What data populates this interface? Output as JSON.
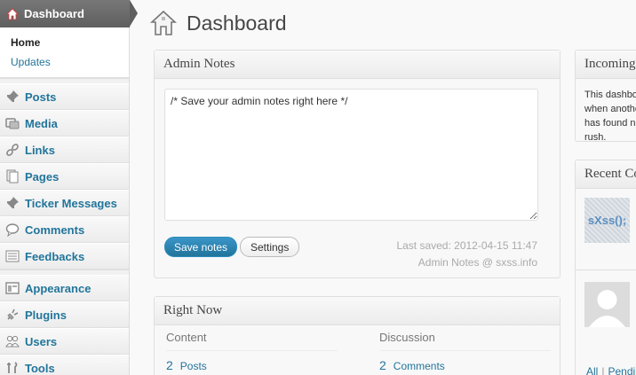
{
  "sidebar": {
    "dashboard_label": "Dashboard",
    "submenu": {
      "home": "Home",
      "updates": "Updates"
    },
    "items": [
      {
        "label": "Posts",
        "icon": "pushpin-icon"
      },
      {
        "label": "Media",
        "icon": "media-icon"
      },
      {
        "label": "Links",
        "icon": "links-icon"
      },
      {
        "label": "Pages",
        "icon": "pages-icon"
      },
      {
        "label": "Ticker Messages",
        "icon": "pushpin-icon"
      },
      {
        "label": "Comments",
        "icon": "comments-icon"
      },
      {
        "label": "Feedbacks",
        "icon": "feedbacks-icon"
      },
      {
        "label": "Appearance",
        "icon": "appearance-icon"
      },
      {
        "label": "Plugins",
        "icon": "plugins-icon"
      },
      {
        "label": "Users",
        "icon": "users-icon"
      },
      {
        "label": "Tools",
        "icon": "tools-icon"
      }
    ]
  },
  "page": {
    "title": "Dashboard"
  },
  "admin_notes": {
    "title": "Admin Notes",
    "text": "/* Save your admin notes right here */",
    "save_label": "Save notes",
    "settings_label": "Settings",
    "last_saved": "Last saved: 2012-04-15 11:47",
    "credit": "Admin Notes @ sxss.info"
  },
  "right_now": {
    "title": "Right Now",
    "content_header": "Content",
    "discussion_header": "Discussion",
    "posts_count": "2",
    "posts_label": "Posts",
    "comments_count": "2",
    "comments_label": "Comments"
  },
  "incoming": {
    "title": "Incoming Links",
    "text": "This dashboard widget queries Google Blog Search so that when another blog links to your site it will show up here. It has found no incoming links… yet. It's okay — there is no rush."
  },
  "recent": {
    "title": "Recent Comments",
    "thumb_text": "sXss();",
    "links": {
      "all": "All",
      "pending": "Pending"
    }
  },
  "colors": {
    "accent": "#21759b",
    "primary_button": "#2e8ec1",
    "sidebar_head": "#6d6d6d"
  }
}
